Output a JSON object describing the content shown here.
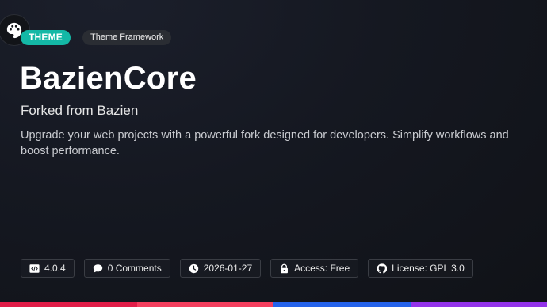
{
  "header": {
    "logo_icon": "palette-icon",
    "type_badge": "THEME",
    "category_badge": "Theme Framework",
    "title": "BazienCore",
    "subtitle": "Forked from Bazien",
    "description": "Upgrade your web projects with a powerful fork designed for developers. Simplify workflows and boost performance."
  },
  "meta": {
    "version": "4.0.4",
    "comments": "0 Comments",
    "date": "2026-01-27",
    "access": "Access: Free",
    "license": "License: GPL 3.0"
  },
  "colors": {
    "accent": "#14b8a6",
    "bar": [
      "#e11d48",
      "#f43f5e",
      "#2563eb",
      "#9333ea"
    ]
  }
}
